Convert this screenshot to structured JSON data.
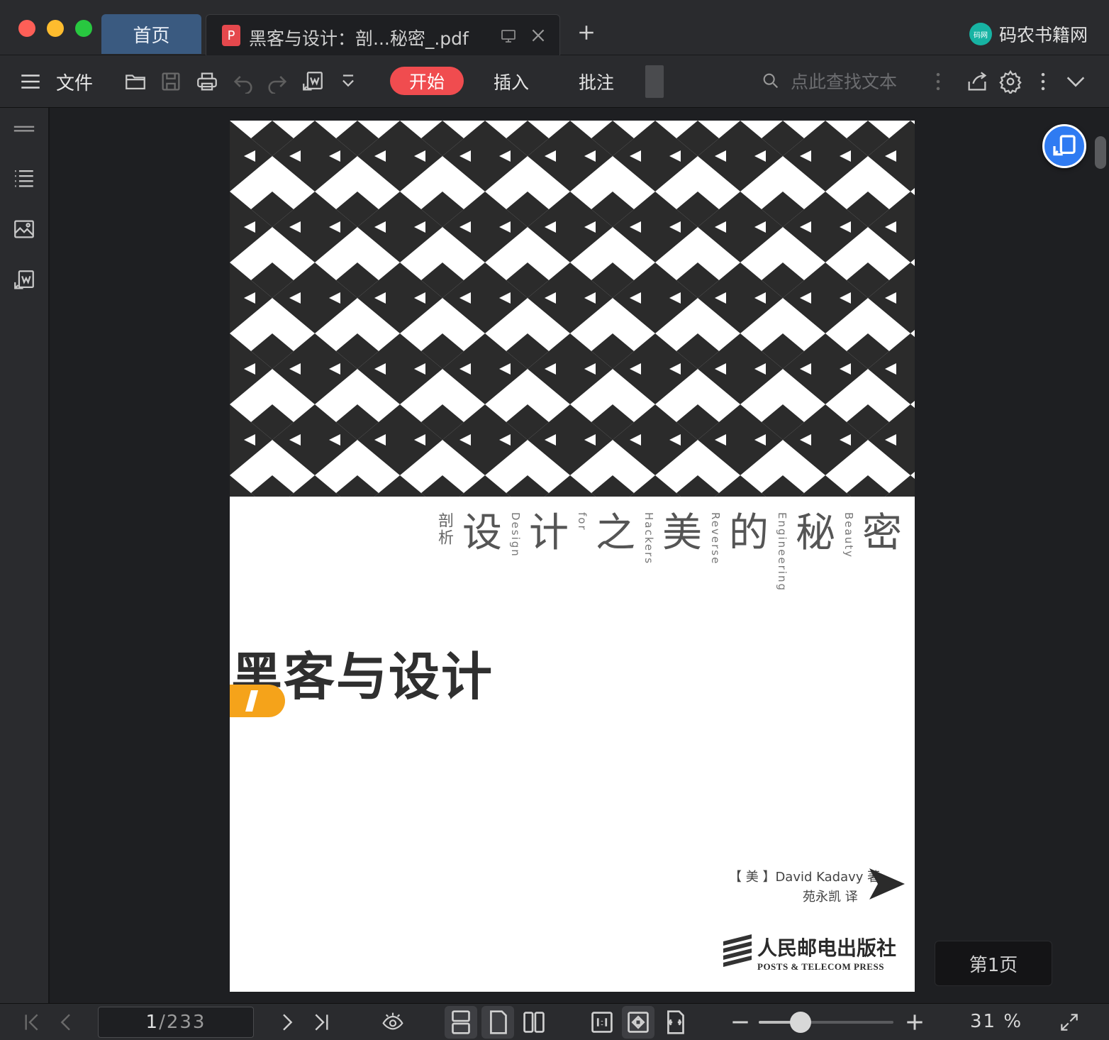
{
  "tabs": {
    "home": "首页",
    "doc_title": "黑客与设计：剖...秘密_.pdf",
    "pdf_glyph": "P"
  },
  "brand": {
    "name": "码农书籍网",
    "logo_text": "码网"
  },
  "toolbar": {
    "file_label": "文件",
    "tabs": [
      "开始",
      "插入",
      "批注"
    ],
    "active_tab": "开始",
    "search_placeholder": "点此查找文本",
    "accent": "#f04c4f"
  },
  "cover": {
    "subtitle_small": "剖析",
    "subtitle_chars": [
      "设",
      "计",
      "之",
      "美",
      "的",
      "秘",
      "密"
    ],
    "subtitle_en": [
      "Design",
      "for",
      "Hackers",
      "Reverse",
      "Engineering",
      "Beauty"
    ],
    "title": "黑客与设计",
    "author": "【 美 】David Kadavy  著",
    "translator": "苑永凯  译",
    "publisher_cn": "人民邮电出版社",
    "publisher_en": "POSTS & TELECOM PRESS"
  },
  "page_badge": "第1页",
  "pager": {
    "current": "1",
    "total": "/233"
  },
  "zoom": {
    "label": "31 %",
    "fraction": 0.31
  },
  "icons": [
    "hamburger-icon",
    "open-folder-icon",
    "save-icon",
    "print-icon",
    "undo-icon",
    "redo-icon",
    "convert-icon",
    "dropdown-icon",
    "search-icon",
    "more-icon",
    "share-icon",
    "gear-icon",
    "chevron-down-icon"
  ]
}
